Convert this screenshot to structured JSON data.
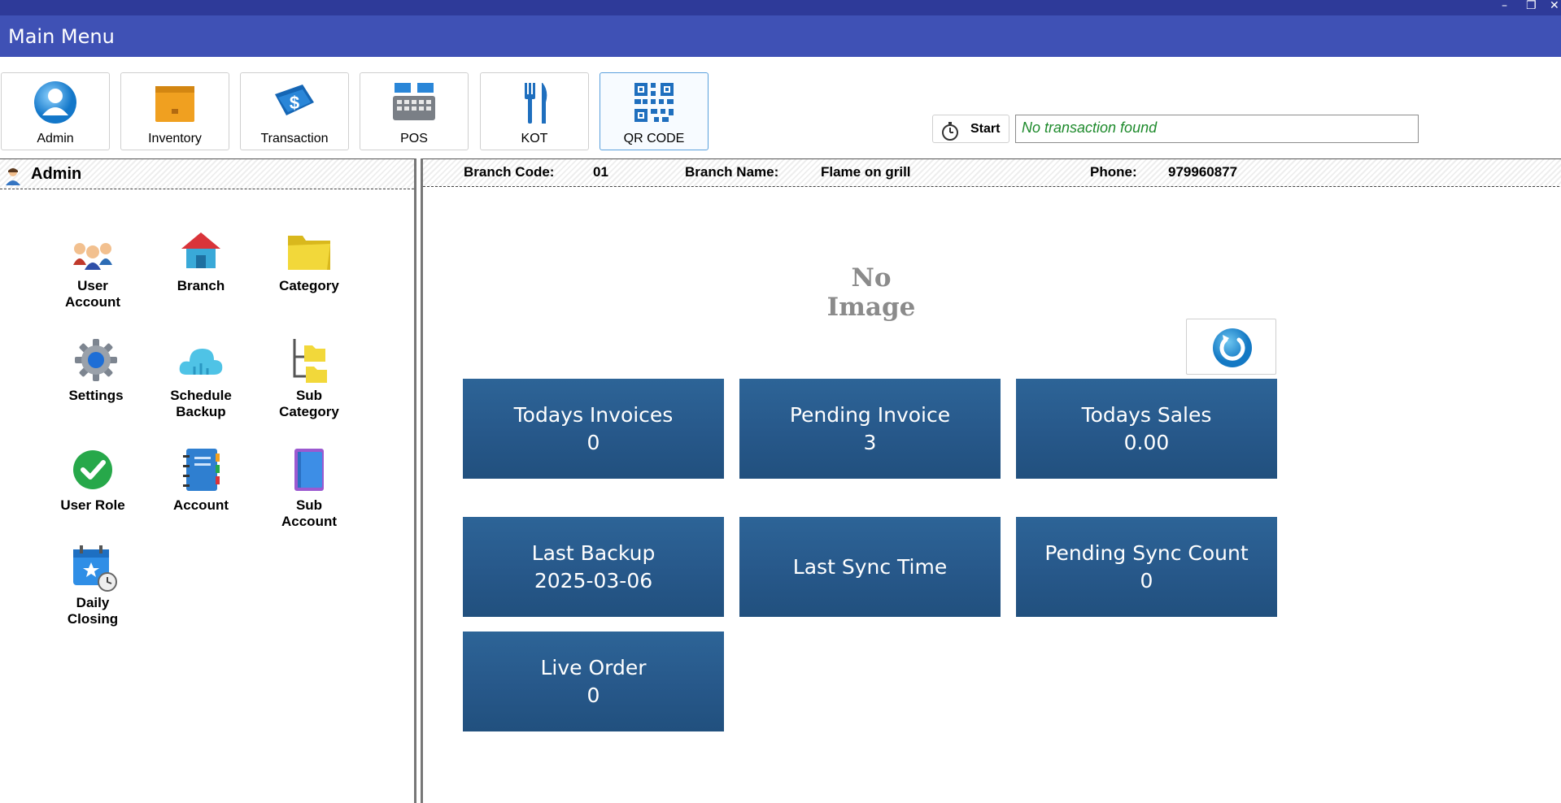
{
  "window": {
    "title": "Main Menu",
    "controls": {
      "minimize": "–",
      "restore": "❐",
      "close": "✕"
    }
  },
  "toolbar": {
    "items": [
      {
        "label": "Admin",
        "icon": "admin-user-icon"
      },
      {
        "label": "Inventory",
        "icon": "inventory-box-icon"
      },
      {
        "label": "Transaction",
        "icon": "transaction-dollar-icon"
      },
      {
        "label": "POS",
        "icon": "pos-register-icon"
      },
      {
        "label": "KOT",
        "icon": "kot-fork-knife-icon"
      },
      {
        "label": "QR CODE",
        "icon": "qr-code-icon"
      }
    ],
    "selected": "QR CODE"
  },
  "timer": {
    "start_label": "Start",
    "status": "No transaction found"
  },
  "left_panel": {
    "title": "Admin",
    "items": [
      {
        "label": "User\nAccount",
        "icon": "users-icon"
      },
      {
        "label": "Branch",
        "icon": "house-icon"
      },
      {
        "label": "Category",
        "icon": "folder-icon"
      },
      {
        "label": "Settings",
        "icon": "gear-icon"
      },
      {
        "label": "Schedule\nBackup",
        "icon": "cloud-icon"
      },
      {
        "label": "Sub\nCategory",
        "icon": "folder-tree-icon"
      },
      {
        "label": "User Role",
        "icon": "checkmark-badge-icon"
      },
      {
        "label": "Account",
        "icon": "ledger-book-icon"
      },
      {
        "label": "Sub\nAccount",
        "icon": "notebook-icon"
      },
      {
        "label": "Daily\nClosing",
        "icon": "calendar-clock-icon"
      }
    ]
  },
  "branch": {
    "code_label": "Branch Code:",
    "code": "01",
    "name_label": "Branch Name:",
    "name": "Flame on grill",
    "phone_label": "Phone:",
    "phone": "979960877"
  },
  "main": {
    "no_image": "No Image",
    "tiles": [
      {
        "title": "Todays Invoices",
        "value": "0"
      },
      {
        "title": "Pending Invoice",
        "value": "3"
      },
      {
        "title": "Todays Sales",
        "value": "0.00"
      },
      {
        "title": "Last Backup",
        "value": "2025-03-06"
      },
      {
        "title": "Last Sync Time",
        "value": ""
      },
      {
        "title": "Pending Sync Count",
        "value": "0"
      },
      {
        "title": "Live Order",
        "value": "0"
      }
    ]
  },
  "colors": {
    "title_bar": "#3f51b5",
    "top_strip": "#2e3a99",
    "tile": "#27588a",
    "status_text": "#1d8a2b"
  }
}
